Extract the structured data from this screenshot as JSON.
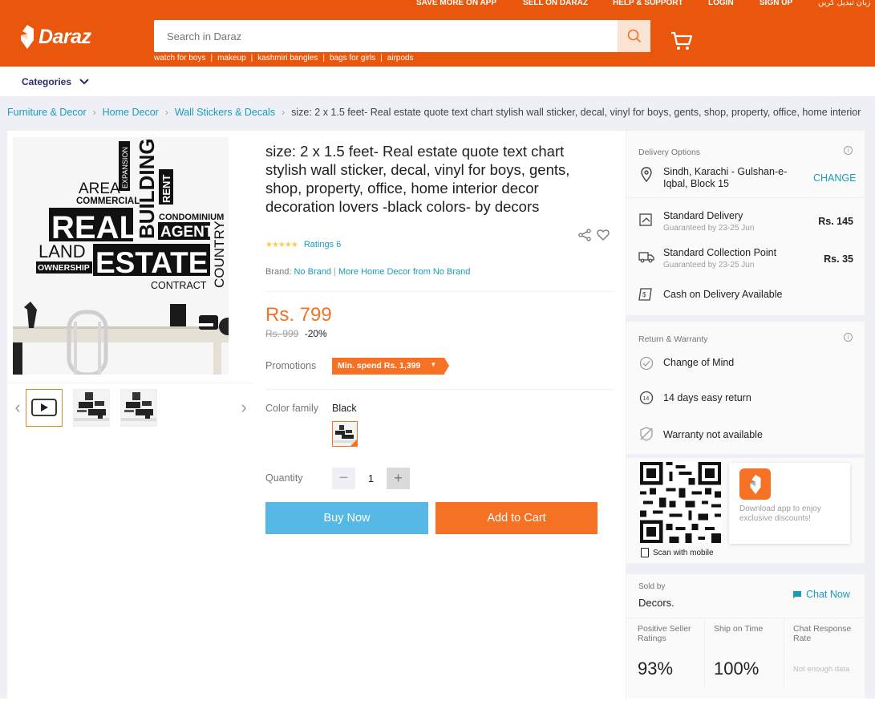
{
  "header": {
    "top_links": [
      "SAVE MORE ON APP",
      "SELL ON DARAZ",
      "HELP & SUPPORT",
      "LOGIN",
      "SIGN UP",
      "زبان تبدیل کریں"
    ],
    "logo_text": "Daraz",
    "search_placeholder": "Search in Daraz",
    "suggestions": [
      "watch for boys",
      "makeup",
      "kashmiri bangles",
      "bags for girls",
      "airpods"
    ],
    "colors": {
      "brand": "#e8570c",
      "accent": "#f57224",
      "link": "#1a9cb7"
    }
  },
  "nav": {
    "categories_label": "Categories"
  },
  "breadcrumb": [
    "Furniture & Decor",
    "Home Decor",
    "Wall Stickers & Decals",
    "size: 2 x 1.5 feet- Real estate quote text chart stylish wall sticker, decal, vinyl for boys, gents, shop, property, office, home interior"
  ],
  "product": {
    "title": "size: 2 x 1.5 feet- Real estate quote text chart stylish wall sticker, decal, vinyl for boys, gents, shop, property, office, home interior decor decoration lovers -black colors- by decors",
    "ratings_text": "Ratings 6",
    "stars": "★★★★★",
    "brand_label": "Brand:",
    "brand_value": "No Brand",
    "more_from": "More Home Decor from No Brand",
    "price": "Rs. 799",
    "old_price": "Rs. 999",
    "discount": "-20%",
    "promotions_label": "Promotions",
    "promo_tag": "Min. spend Rs. 1,399",
    "color_label": "Color family",
    "color_value": "Black",
    "quantity_label": "Quantity",
    "quantity": "1",
    "buy_now": "Buy Now",
    "add_to_cart": "Add to Cart",
    "image_words": {
      "area": "AREA",
      "expansion": "EXPANSION",
      "building": "BUILDING",
      "commercial": "COMMERCIAL",
      "rent": "RENT",
      "real": "REAL",
      "condominium": "CONDOMINIUM",
      "agent": "AGENT",
      "land": "LAND",
      "estate": "ESTATE",
      "country": "COUNTRY",
      "ownership": "OWNERSHIP",
      "contract": "CONTRACT"
    }
  },
  "delivery": {
    "title": "Delivery Options",
    "location": "Sindh, Karachi - Gulshan-e-Iqbal, Block 15",
    "change": "CHANGE",
    "options": [
      {
        "name": "Standard Delivery",
        "sub": "Guaranteed by 23-25 Jun",
        "price": "Rs. 145"
      },
      {
        "name": "Standard Collection Point",
        "sub": "Guaranteed by 23-25 Jun",
        "price": "Rs. 35"
      }
    ],
    "cod": "Cash on Delivery Available"
  },
  "returns": {
    "title": "Return & Warranty",
    "items": [
      "Change of Mind",
      "14 days easy return",
      "Warranty not available"
    ]
  },
  "app": {
    "download_text": "Download app to enjoy exclusive discounts!",
    "scan_text": "Scan with mobile"
  },
  "seller": {
    "sold_by_label": "Sold by",
    "name": "Decors.",
    "chat": "Chat Now",
    "metrics": [
      {
        "label": "Positive Seller Ratings",
        "value": "93%"
      },
      {
        "label": "Ship on Time",
        "value": "100%"
      },
      {
        "label": "Chat Response Rate",
        "value": "Not enough data"
      }
    ]
  }
}
